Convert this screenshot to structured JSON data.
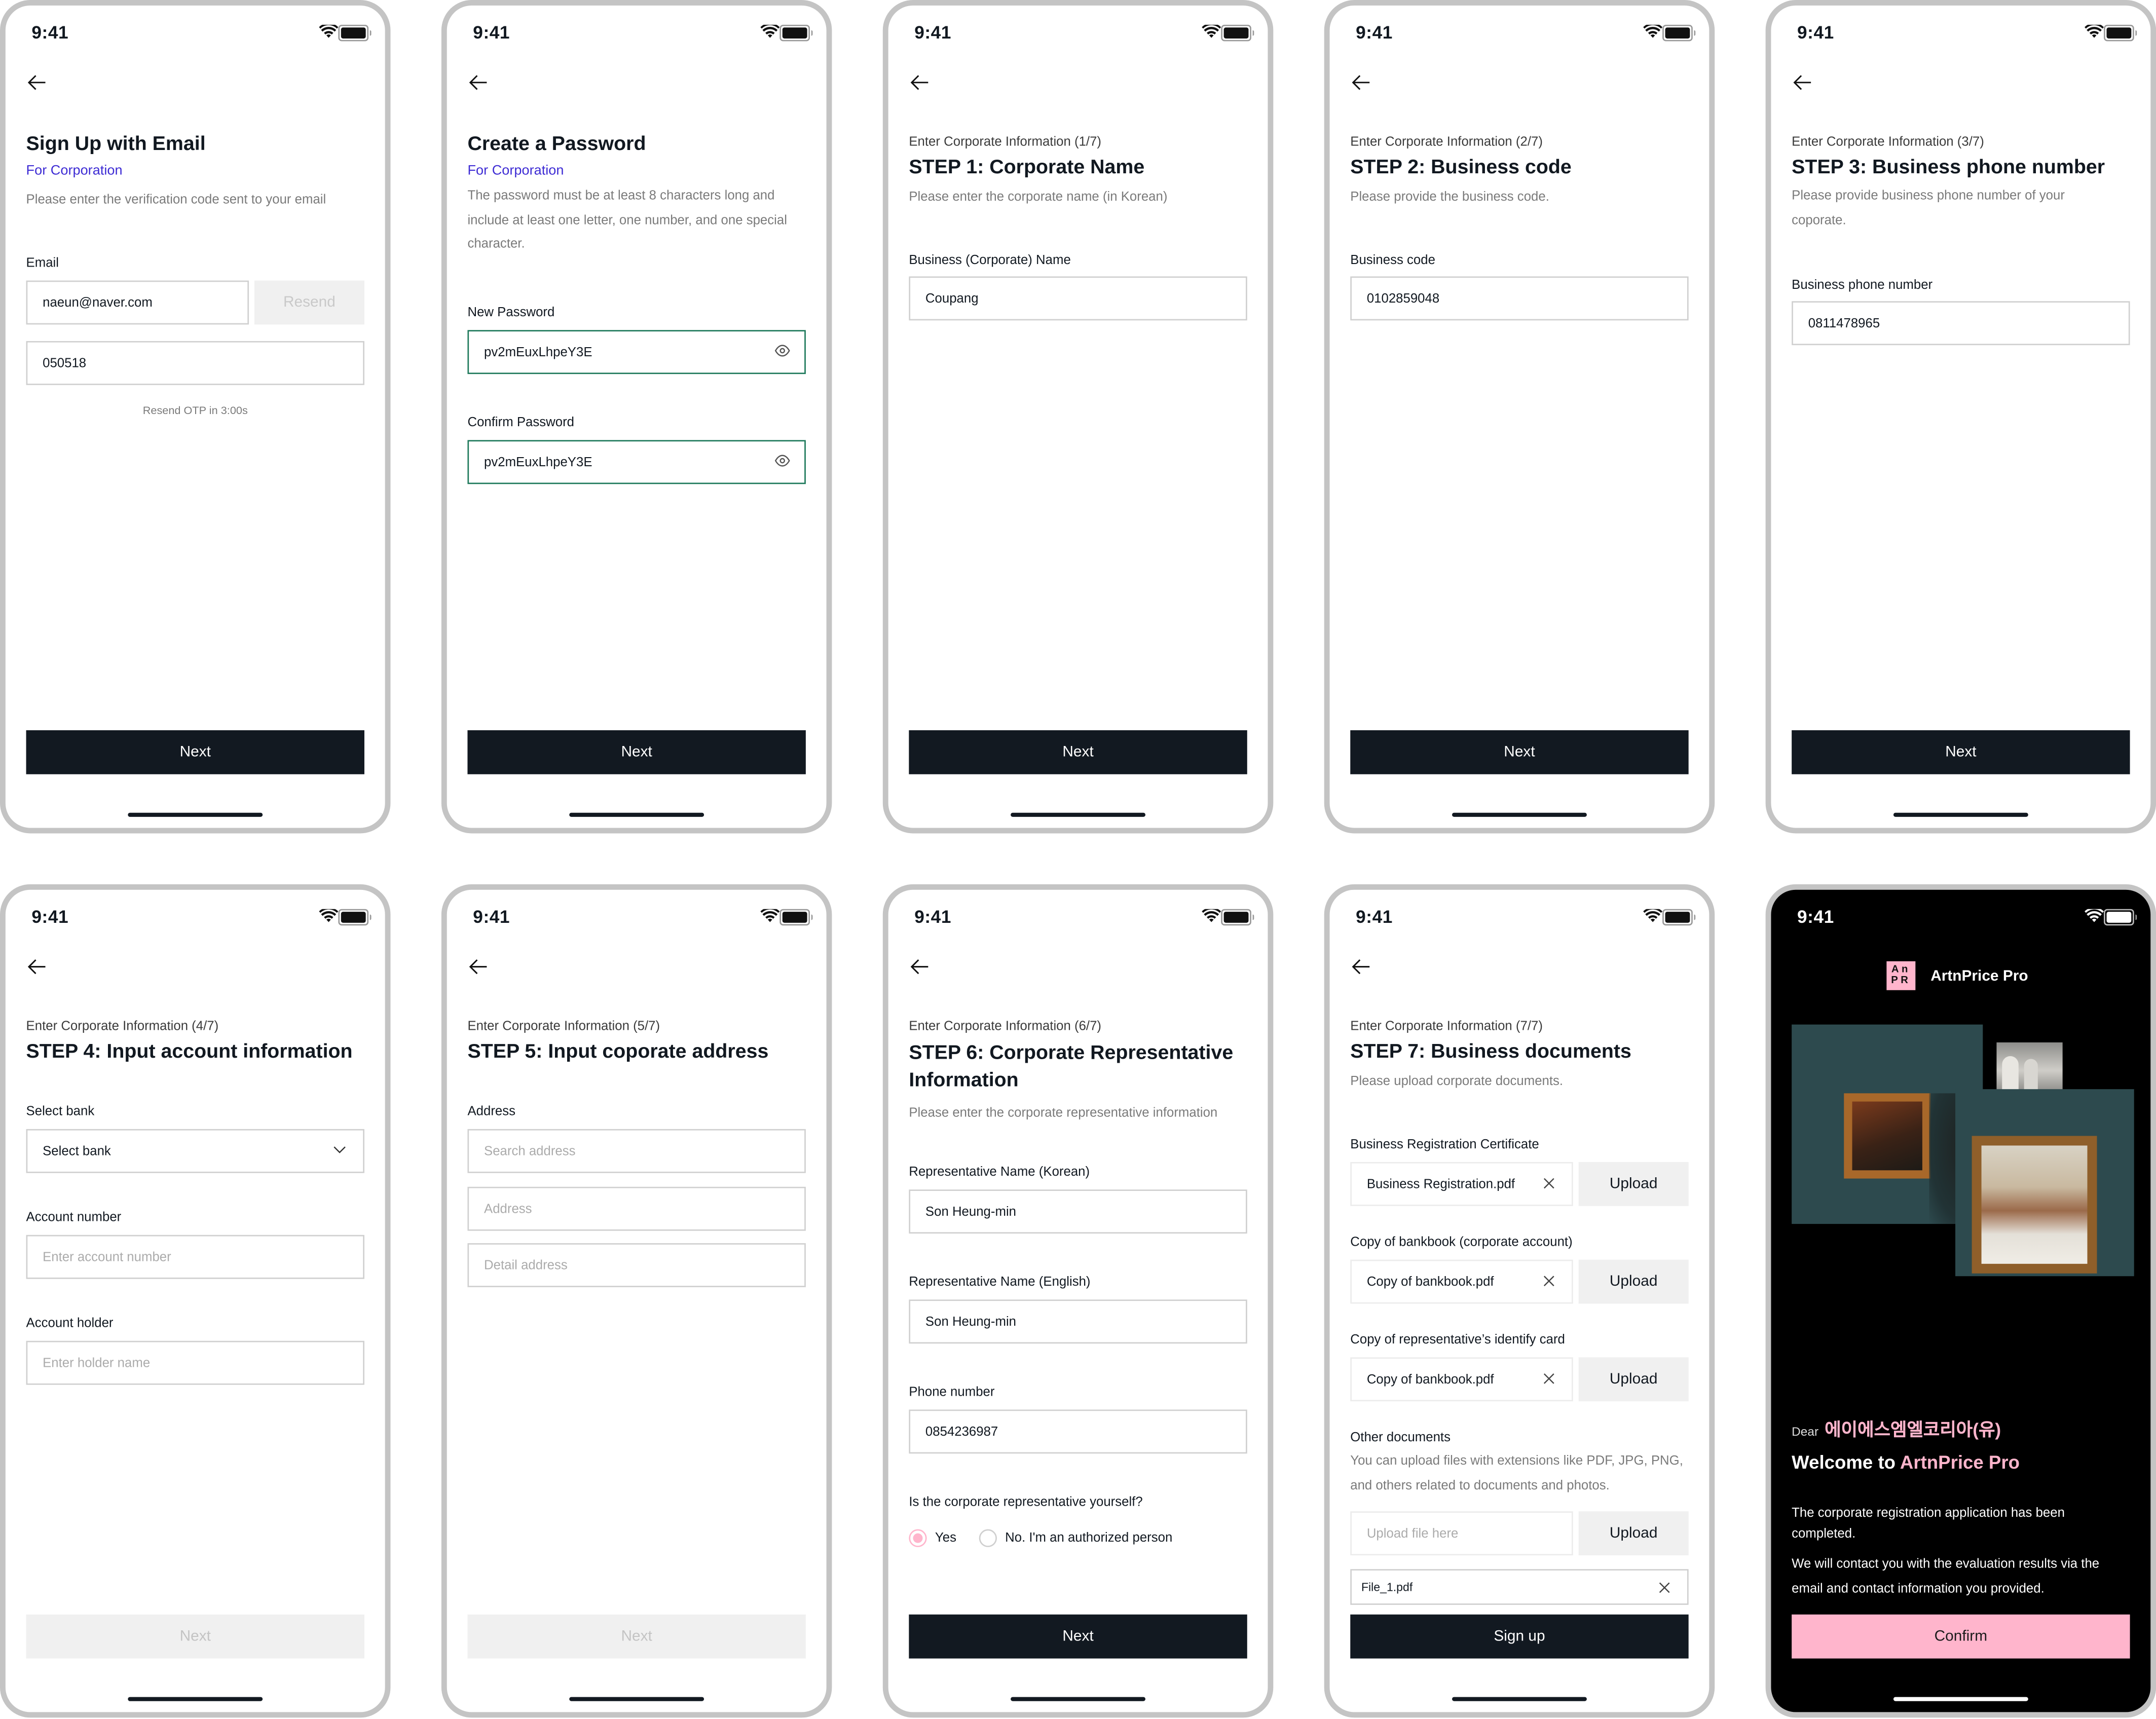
{
  "status_bar": {
    "time": "9:41"
  },
  "screens": {
    "email": {
      "title": "Sign Up with Email",
      "subtitle": "For Corporation",
      "description": "Please enter the verification code sent to your email",
      "email_label": "Email",
      "email_value": "naeun@naver.com",
      "resend_label": "Resend",
      "otp_value": "050518",
      "resend_timer": "Resend OTP in 3:00s",
      "next_label": "Next"
    },
    "password": {
      "title": "Create a Password",
      "subtitle": "For Corporation",
      "description": "The password must be at least 8 characters long and include at least one letter, one number, and one special character.",
      "new_label": "New Password",
      "new_value": "pv2mEuxLhpeY3E",
      "confirm_label": "Confirm Password",
      "confirm_value": "pv2mEuxLhpeY3E",
      "next_label": "Next"
    },
    "step1": {
      "progress": "Enter Corporate Information (1/7)",
      "title": "STEP 1: Corporate Name",
      "description": "Please enter the corporate name (in Korean)",
      "field_label": "Business (Corporate) Name",
      "field_value": "Coupang",
      "next_label": "Next"
    },
    "step2": {
      "progress": "Enter Corporate Information (2/7)",
      "title": "STEP 2: Business code",
      "description": "Please provide the business code.",
      "field_label": "Business code",
      "field_value": "0102859048",
      "next_label": "Next"
    },
    "step3": {
      "progress": "Enter Corporate Information (3/7)",
      "title": "STEP 3: Business phone number",
      "description": "Please provide business phone number of your coporate.",
      "field_label": "Business phone number",
      "field_value": "0811478965",
      "next_label": "Next"
    },
    "step4": {
      "progress": "Enter Corporate Information (4/7)",
      "title": "STEP 4: Input account information",
      "bank_label": "Select bank",
      "bank_selected": "Select bank",
      "account_label": "Account number",
      "account_placeholder": "Enter account number",
      "holder_label": "Account holder",
      "holder_placeholder": "Enter holder name",
      "next_label": "Next"
    },
    "step5": {
      "progress": "Enter Corporate Information (5/7)",
      "title": "STEP 5: Input coporate address",
      "address_label": "Address",
      "search_placeholder": "Search address",
      "address_placeholder": "Address",
      "detail_placeholder": "Detail address",
      "next_label": "Next"
    },
    "step6": {
      "progress": "Enter Corporate Information (6/7)",
      "title": "STEP 6: Corporate Representative Information",
      "description": "Please enter the corporate representative information",
      "name_ko_label": "Representative Name (Korean)",
      "name_ko_value": "Son Heung-min",
      "name_en_label": "Representative Name (English)",
      "name_en_value": "Son Heung-min",
      "phone_label": "Phone number",
      "phone_value": "0854236987",
      "question": "Is the corporate representative yourself?",
      "option_yes": "Yes",
      "option_no": "No. I'm an authorized person",
      "selected_option": "Yes",
      "next_label": "Next"
    },
    "step7": {
      "progress": "Enter Corporate Information (7/7)",
      "title": "STEP 7: Business documents",
      "description": "Please upload corporate documents.",
      "documents": [
        {
          "label": "Business Registration Certificate",
          "file": "Business Registration.pdf",
          "button": "Upload"
        },
        {
          "label": "Copy of bankbook (corporate account)",
          "file": "Copy of bankbook.pdf",
          "button": "Upload"
        },
        {
          "label": "Copy of representative’s identify card",
          "file": "Copy of bankbook.pdf",
          "button": "Upload"
        }
      ],
      "other_label": "Other documents",
      "other_description": "You can upload files with extensions like PDF, JPG, PNG, and others related to documents and photos.",
      "other_placeholder": "Upload file here",
      "other_button": "Upload",
      "uploaded_file": "File_1.pdf",
      "submit_label": "Sign up"
    },
    "welcome": {
      "logo_text_top": "An",
      "logo_text_bottom": "PR",
      "brand": "ArtnPrice Pro",
      "dear": "Dear",
      "company": "에이에스엠엘코리아(유)",
      "welcome_prefix": "Welcome to",
      "welcome_brand": "ArtnPrice Pro",
      "message1": "The corporate registration application has been completed.",
      "message2": "We will contact you with the evaluation results via the email and contact information you provided.",
      "confirm_label": "Confirm"
    }
  },
  "colors": {
    "primary_button": "#121921",
    "accent_purple": "#3d2bd4",
    "focus_green": "#1f7a5c",
    "brand_pink": "#ffb5cc",
    "disabled_grey": "#f0f0f0",
    "frame_grey": "#c4c4c4"
  }
}
